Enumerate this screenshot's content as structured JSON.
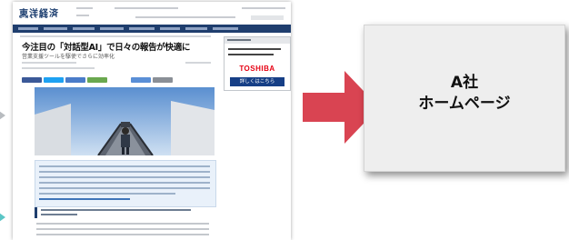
{
  "article": {
    "logo": "東洋経済",
    "logo_sub": "ONLINE",
    "title": "今注目の「対話型AI」で日々の報告が快適に",
    "subtitle": "営業支援ツールを駆使でさらに効率化"
  },
  "ad": {
    "brand": "TOSHIBA",
    "button_label": "詳しくはこちら"
  },
  "target": {
    "line1": "A社",
    "line2": "ホームページ"
  },
  "colors": {
    "nav": "#1f3e6e",
    "arrow": "#d94452",
    "teal": "#5bc6c6",
    "toshiba_red": "#e60012"
  },
  "icons": {
    "left_arrows": [
      "arrow-right-icon",
      "arrow-right-icon"
    ],
    "main_arrow": "arrow-right-icon"
  }
}
